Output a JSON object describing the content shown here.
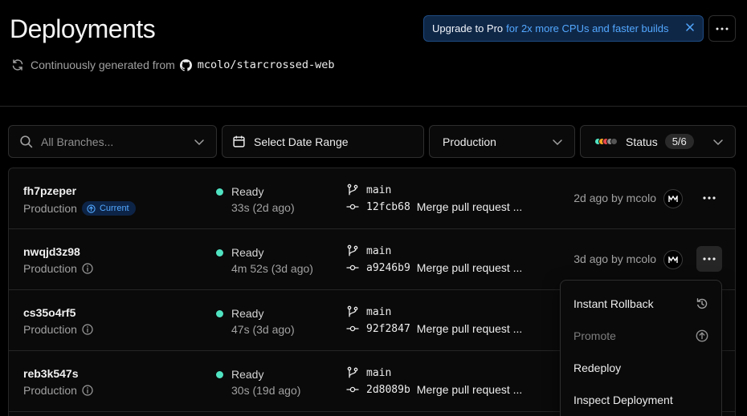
{
  "header": {
    "title": "Deployments",
    "subtitle_prefix": "Continuously generated from",
    "repo": "mcolo/starcrossed-web"
  },
  "banner": {
    "strong": "Upgrade to Pro",
    "text": "for 2x more CPUs and faster builds"
  },
  "filters": {
    "search_placeholder": "All Branches...",
    "date_label": "Select Date Range",
    "environment": "Production",
    "status_label": "Status",
    "status_count": "5/6"
  },
  "colors": {
    "accent_blue": "#52a8ff",
    "ready_green": "#50e3c2",
    "status_dots": [
      "#50e3c2",
      "#f5a623",
      "#e5484d",
      "#8f8f8f",
      "#555555"
    ]
  },
  "deployments": [
    {
      "id": "fh7pzeper",
      "environment": "Production",
      "badge": "Current",
      "status": "Ready",
      "duration": "33s (2d ago)",
      "branch": "main",
      "commit": "12fcb68",
      "message": "Merge pull request ...",
      "when": "2d ago by mcolo"
    },
    {
      "id": "nwqjd3z98",
      "environment": "Production",
      "badge": "",
      "status": "Ready",
      "duration": "4m 52s (3d ago)",
      "branch": "main",
      "commit": "a9246b9",
      "message": "Merge pull request ...",
      "when": "3d ago by mcolo"
    },
    {
      "id": "cs35o4rf5",
      "environment": "Production",
      "badge": "",
      "status": "Ready",
      "duration": "47s (3d ago)",
      "branch": "main",
      "commit": "92f2847",
      "message": "Merge pull request ...",
      "when": ""
    },
    {
      "id": "reb3k547s",
      "environment": "Production",
      "badge": "",
      "status": "Ready",
      "duration": "30s (19d ago)",
      "branch": "main",
      "commit": "2d8089b",
      "message": "Merge pull request ...",
      "when": ""
    }
  ],
  "menu": {
    "items": [
      {
        "label": "Instant Rollback",
        "icon": "rollback-icon",
        "disabled": false
      },
      {
        "label": "Promote",
        "icon": "promote-icon",
        "disabled": true
      },
      {
        "label": "Redeploy",
        "icon": "",
        "disabled": false
      },
      {
        "label": "Inspect Deployment",
        "icon": "",
        "disabled": false
      }
    ]
  }
}
